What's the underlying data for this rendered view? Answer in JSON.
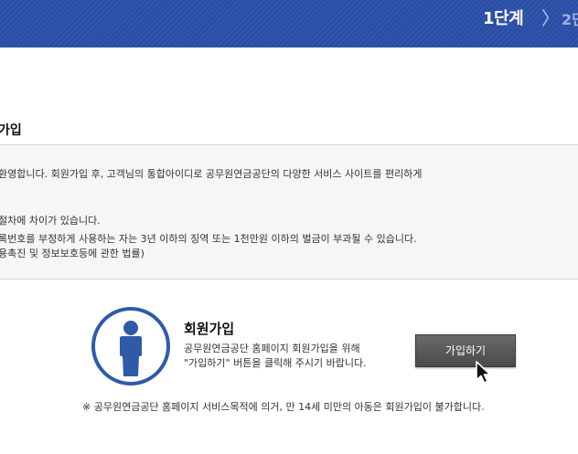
{
  "header": {
    "step_current": "1단계",
    "step_chevron": "〉",
    "step_next": "2단"
  },
  "section": {
    "title": "가입"
  },
  "info": {
    "lines": [
      "환영합니다. 회원가입 후, 고객님의 통합아이디로 공무원연금공단의 다양한 서비스 사이트를 편리하게",
      "절차에 차이가 있습니다.",
      "록번호를 부정하게 사용하는 자는 3년 이하의 징역 또는 1천만원 이하의 벌금이 부과될 수 있습니다.",
      "용촉진 및 정보보호등에 관한 법률)"
    ]
  },
  "join": {
    "title": "회원가입",
    "desc_line1": "공무원연금공단 홈페이지 회원가입을 위해",
    "desc_line2": "\"가입하기\" 버튼을 클릭해 주시기 바랍니다.",
    "button_label": "가입하기"
  },
  "notice": "※ 공무원연금공단 홈페이지 서비스목적에 의거, 만 14세 미만의 아동은 회원가입이 불가합니다.",
  "colors": {
    "header_bg": "#2a4ea5",
    "person_blue": "#2f5aa8",
    "button_bg": "#555555"
  },
  "icons": {
    "person": "person-icon",
    "cursor": "mouse-cursor-icon"
  }
}
